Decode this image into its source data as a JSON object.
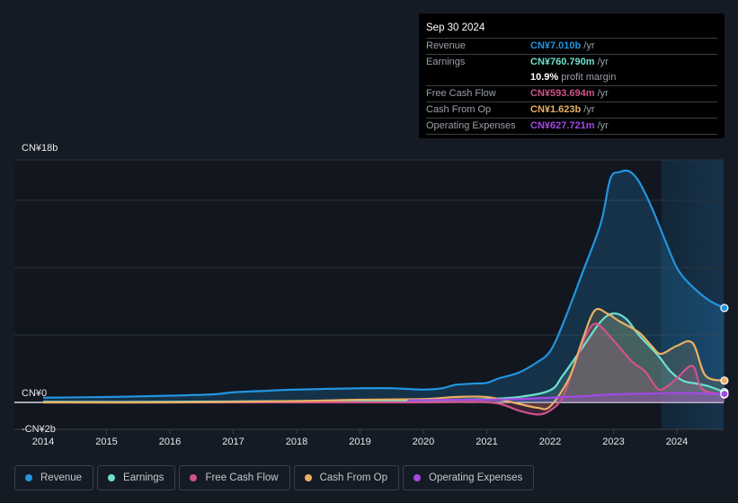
{
  "tooltip": {
    "date": "Sep 30 2024",
    "rows": [
      {
        "label": "Revenue",
        "value": "CN¥7.010b",
        "unit": "/yr",
        "color": "#2394df"
      },
      {
        "label": "Earnings",
        "value": "CN¥760.790m",
        "unit": "/yr",
        "color": "#6ee0cf"
      },
      {
        "label": "",
        "value": "10.9%",
        "unit": "profit margin",
        "color": "#ffffff"
      },
      {
        "label": "Free Cash Flow",
        "value": "CN¥593.694m",
        "unit": "/yr",
        "color": "#d0538a"
      },
      {
        "label": "Cash From Op",
        "value": "CN¥1.623b",
        "unit": "/yr",
        "color": "#e9b064"
      },
      {
        "label": "Operating Expenses",
        "value": "CN¥627.721m",
        "unit": "/yr",
        "color": "#a249e6"
      }
    ]
  },
  "chart_data": {
    "type": "area",
    "title": "",
    "xlabel": "",
    "ylabel": "",
    "y_tick_labels": [
      {
        "value": 18,
        "label": "CN¥18b"
      },
      {
        "value": 0,
        "label": "CN¥0"
      },
      {
        "value": -2,
        "label": "-CN¥2b"
      }
    ],
    "gridlines": [
      18,
      15,
      10,
      5
    ],
    "ylim": [
      -2,
      18
    ],
    "xlim": [
      2014,
      2024.75
    ],
    "x_ticks": [
      2014,
      2015,
      2016,
      2017,
      2018,
      2019,
      2020,
      2021,
      2022,
      2023,
      2024
    ],
    "unit": "CN¥ billions",
    "highlight_region_start": 2023.75,
    "legend_position": "bottom-left",
    "series": [
      {
        "name": "Revenue",
        "color": "#2394df",
        "points": [
          [
            2014,
            0.35
          ],
          [
            2015,
            0.4
          ],
          [
            2016,
            0.5
          ],
          [
            2016.7,
            0.6
          ],
          [
            2017,
            0.75
          ],
          [
            2017.7,
            0.9
          ],
          [
            2018,
            0.95
          ],
          [
            2019,
            1.05
          ],
          [
            2019.5,
            1.05
          ],
          [
            2020,
            0.95
          ],
          [
            2020.3,
            1.05
          ],
          [
            2020.5,
            1.3
          ],
          [
            2020.8,
            1.4
          ],
          [
            2021,
            1.45
          ],
          [
            2021.2,
            1.8
          ],
          [
            2021.5,
            2.2
          ],
          [
            2021.8,
            3.0
          ],
          [
            2022,
            3.8
          ],
          [
            2022.2,
            5.8
          ],
          [
            2022.5,
            9.5
          ],
          [
            2022.8,
            13.3
          ],
          [
            2022.95,
            16.6
          ],
          [
            2023.1,
            17.1
          ],
          [
            2023.25,
            17.15
          ],
          [
            2023.4,
            16.4
          ],
          [
            2023.6,
            14.5
          ],
          [
            2023.8,
            12.2
          ],
          [
            2024,
            10.0
          ],
          [
            2024.2,
            8.8
          ],
          [
            2024.5,
            7.6
          ],
          [
            2024.75,
            7.01
          ]
        ]
      },
      {
        "name": "Earnings",
        "color": "#6ee0cf",
        "points": [
          [
            2014,
            0.05
          ],
          [
            2016,
            0.05
          ],
          [
            2018,
            0.1
          ],
          [
            2020,
            0.15
          ],
          [
            2020.5,
            0.2
          ],
          [
            2021,
            0.25
          ],
          [
            2021.5,
            0.4
          ],
          [
            2022,
            0.9
          ],
          [
            2022.2,
            2.0
          ],
          [
            2022.5,
            4.0
          ],
          [
            2022.8,
            6.0
          ],
          [
            2023.0,
            6.6
          ],
          [
            2023.2,
            6.2
          ],
          [
            2023.4,
            5.0
          ],
          [
            2023.7,
            3.5
          ],
          [
            2023.9,
            2.3
          ],
          [
            2024.1,
            1.6
          ],
          [
            2024.3,
            1.4
          ],
          [
            2024.5,
            1.2
          ],
          [
            2024.75,
            0.76
          ]
        ]
      },
      {
        "name": "Free Cash Flow",
        "color": "#d0538a",
        "points": [
          [
            2014,
            0.0
          ],
          [
            2018,
            0.0
          ],
          [
            2020,
            0.0
          ],
          [
            2020.8,
            0.05
          ],
          [
            2021.2,
            -0.1
          ],
          [
            2021.5,
            -0.6
          ],
          [
            2021.8,
            -0.9
          ],
          [
            2022,
            -0.6
          ],
          [
            2022.2,
            0.4
          ],
          [
            2022.4,
            3.0
          ],
          [
            2022.6,
            5.3
          ],
          [
            2022.75,
            5.8
          ],
          [
            2023.0,
            4.6
          ],
          [
            2023.3,
            3.0
          ],
          [
            2023.5,
            2.3
          ],
          [
            2023.7,
            1.0
          ],
          [
            2023.85,
            1.2
          ],
          [
            2024.0,
            1.8
          ],
          [
            2024.25,
            2.7
          ],
          [
            2024.4,
            1.0
          ],
          [
            2024.75,
            0.59
          ]
        ]
      },
      {
        "name": "Cash From Op",
        "color": "#e9b064",
        "points": [
          [
            2014,
            0.0
          ],
          [
            2016,
            0.0
          ],
          [
            2018,
            0.1
          ],
          [
            2019,
            0.2
          ],
          [
            2020,
            0.25
          ],
          [
            2020.5,
            0.4
          ],
          [
            2021,
            0.4
          ],
          [
            2021.5,
            -0.1
          ],
          [
            2021.8,
            -0.4
          ],
          [
            2022,
            -0.3
          ],
          [
            2022.3,
            1.8
          ],
          [
            2022.5,
            4.5
          ],
          [
            2022.7,
            6.8
          ],
          [
            2022.9,
            6.6
          ],
          [
            2023.1,
            6.0
          ],
          [
            2023.4,
            5.2
          ],
          [
            2023.6,
            4.2
          ],
          [
            2023.75,
            3.6
          ],
          [
            2024,
            4.2
          ],
          [
            2024.25,
            4.4
          ],
          [
            2024.45,
            2.0
          ],
          [
            2024.75,
            1.62
          ]
        ]
      },
      {
        "name": "Operating Expenses",
        "color": "#a249e6",
        "points": [
          [
            2019.75,
            0.15
          ],
          [
            2020.5,
            0.2
          ],
          [
            2021,
            0.2
          ],
          [
            2021.5,
            0.25
          ],
          [
            2022,
            0.35
          ],
          [
            2022.5,
            0.45
          ],
          [
            2023,
            0.6
          ],
          [
            2023.5,
            0.65
          ],
          [
            2024,
            0.7
          ],
          [
            2024.75,
            0.63
          ]
        ]
      }
    ]
  },
  "legend": [
    {
      "label": "Revenue",
      "color": "#2394df"
    },
    {
      "label": "Earnings",
      "color": "#6ee0cf"
    },
    {
      "label": "Free Cash Flow",
      "color": "#d0538a"
    },
    {
      "label": "Cash From Op",
      "color": "#e9b064"
    },
    {
      "label": "Operating Expenses",
      "color": "#a249e6"
    }
  ]
}
